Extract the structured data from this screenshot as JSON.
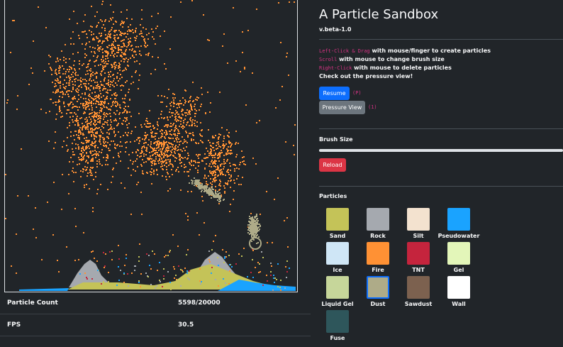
{
  "app": {
    "title": "A Particle Sandbox",
    "version": "v.beta-1.0"
  },
  "instructions": [
    {
      "key": "Left-Click & Drag",
      "text": " with mouse/finger to create particles"
    },
    {
      "key": "Scroll",
      "text": " with mouse to change brush size"
    },
    {
      "key": "Right-Click",
      "text": " with mouse to delete particles"
    },
    {
      "key": "",
      "text": "Check out the pressure view!"
    }
  ],
  "controls": {
    "resume_label": "Resume",
    "resume_key": "(P)",
    "pressure_label": "Pressure View",
    "pressure_key": "(1)",
    "brush_label": "Brush Size",
    "reload_label": "Reload"
  },
  "brush_size": 1.0,
  "particles_heading": "Particles",
  "particles": [
    {
      "name": "Sand",
      "color": "#c4c358",
      "selected": false
    },
    {
      "name": "Rock",
      "color": "#a5a9af",
      "selected": false
    },
    {
      "name": "Silt",
      "color": "#f3e2cf",
      "selected": false
    },
    {
      "name": "Pseudowater",
      "color": "#1aa3ff",
      "selected": false
    },
    {
      "name": "Ice",
      "color": "#cfe6f6",
      "selected": false
    },
    {
      "name": "Fire",
      "color": "#ff9134",
      "selected": false
    },
    {
      "name": "TNT",
      "color": "#c5243d",
      "selected": false
    },
    {
      "name": "Gel",
      "color": "#e3f6b9",
      "selected": false
    },
    {
      "name": "Liquid Gel",
      "color": "#c6d69a",
      "selected": false
    },
    {
      "name": "Dust",
      "color": "#aeab88",
      "selected": true
    },
    {
      "name": "Sawdust",
      "color": "#7c614f",
      "selected": false
    },
    {
      "name": "Wall",
      "color": "#ffffff",
      "selected": false
    },
    {
      "name": "Fuse",
      "color": "#2e565b",
      "selected": false
    }
  ],
  "stats": {
    "particle_count_label": "Particle Count",
    "particle_count_value": "5598/20000",
    "fps_label": "FPS",
    "fps_value": "30.5"
  },
  "colors": {
    "background": "#212529",
    "fire": "#ff9134",
    "sand": "#c4c358",
    "rock": "#a5a9af",
    "water": "#1aa3ff",
    "dust": "#aeab88",
    "tnt": "#c5243d"
  }
}
